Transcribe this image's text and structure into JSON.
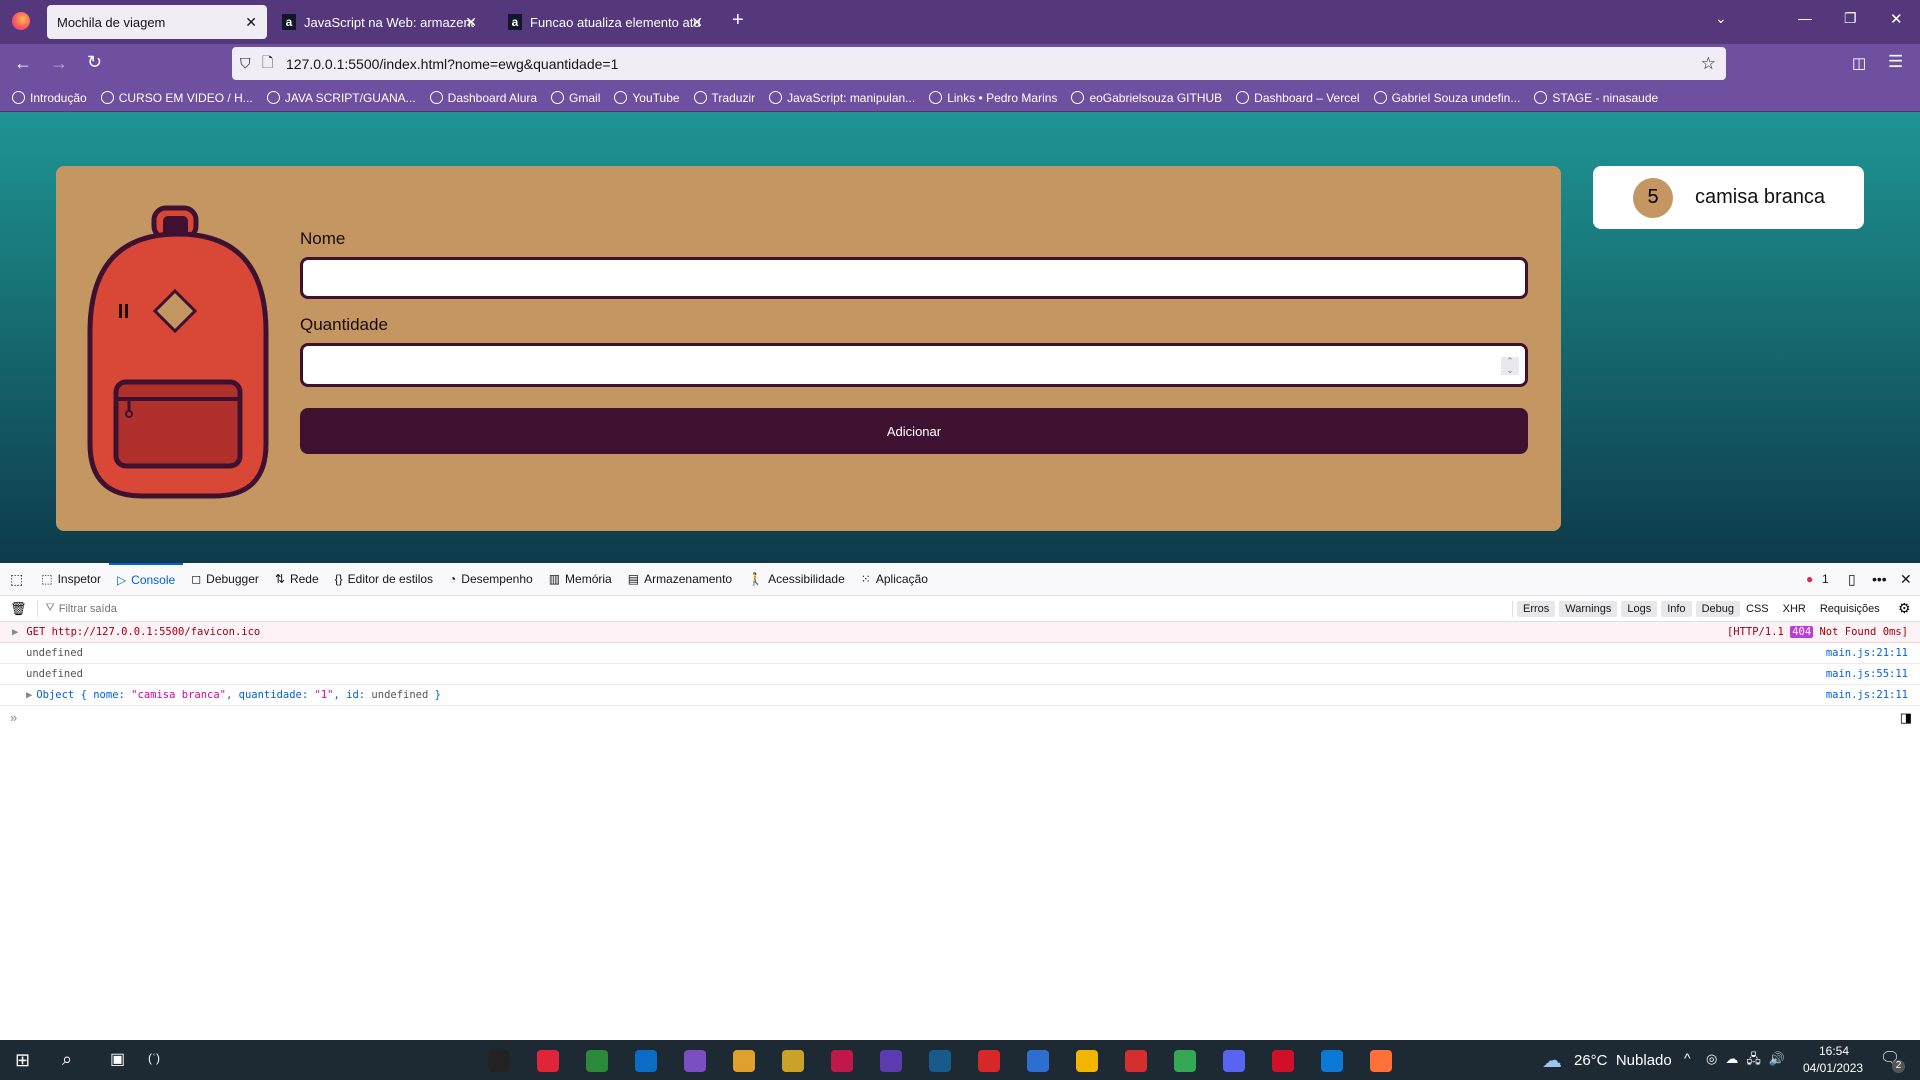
{
  "browser": {
    "tabs": [
      {
        "label": "Mochila de viagem",
        "active": true
      },
      {
        "label": "JavaScript na Web: armazenand"
      },
      {
        "label": "Funcao atualiza elemento atuali"
      }
    ],
    "url": "127.0.0.1:5500/index.html?nome=ewg&quantidade=1",
    "bookmarks": [
      "Introdução",
      "CURSO EM VIDEO / H...",
      "JAVA SCRIPT/GUANA...",
      "Dashboard Alura",
      "Gmail",
      "YouTube",
      "Traduzir",
      "JavaScript: manipulan...",
      "Links • Pedro Marins",
      "eoGabrielsouza GITHUB",
      "Dashboard – Vercel",
      "Gabriel Souza undefin...",
      "STAGE - ninasaude"
    ]
  },
  "form": {
    "nome_label": "Nome",
    "nome_value": "",
    "quantidade_label": "Quantidade",
    "quantidade_value": "",
    "submit_label": "Adicionar"
  },
  "list": [
    {
      "quantidade": "5",
      "nome": "camisa branca"
    }
  ],
  "devtools": {
    "tabs": [
      "Inspetor",
      "Console",
      "Debugger",
      "Rede",
      "Editor de estilos",
      "Desempenho",
      "Memória",
      "Armazenamento",
      "Acessibilidade",
      "Aplicação"
    ],
    "active_tab": "Console",
    "error_count": "1",
    "filter_placeholder": "Filtrar saída",
    "level_filters": [
      "Erros",
      "Warnings",
      "Logs",
      "Info",
      "Debug"
    ],
    "extra_filters": [
      "CSS",
      "XHR",
      "Requisições"
    ],
    "messages": [
      {
        "text": "GET http://127.0.0.1:5500/favicon.ico",
        "status_prefix": "[HTTP/1.1",
        "status_code": "404",
        "status_suffix": "Not Found 0ms]",
        "type": "error"
      },
      {
        "text": "undefined",
        "source": "main.js:21:11"
      },
      {
        "text": "undefined",
        "source": "main.js:55:11"
      },
      {
        "object_prefix": "Object {",
        "k1": "nome:",
        "v1": "\"camisa branca\"",
        "k2": ", quantidade:",
        "v2": "\"1\"",
        "k3": ", id:",
        "v3": "undefined",
        "object_suffix": "}",
        "source": "main.js:21:11"
      }
    ]
  },
  "taskbar": {
    "weather": "26°C  Nublado",
    "time": "16:54",
    "date": "04/01/2023",
    "notifications": "2"
  },
  "colors": {
    "card": "#c49661",
    "button": "#3e1130",
    "browser": "#55387c"
  }
}
